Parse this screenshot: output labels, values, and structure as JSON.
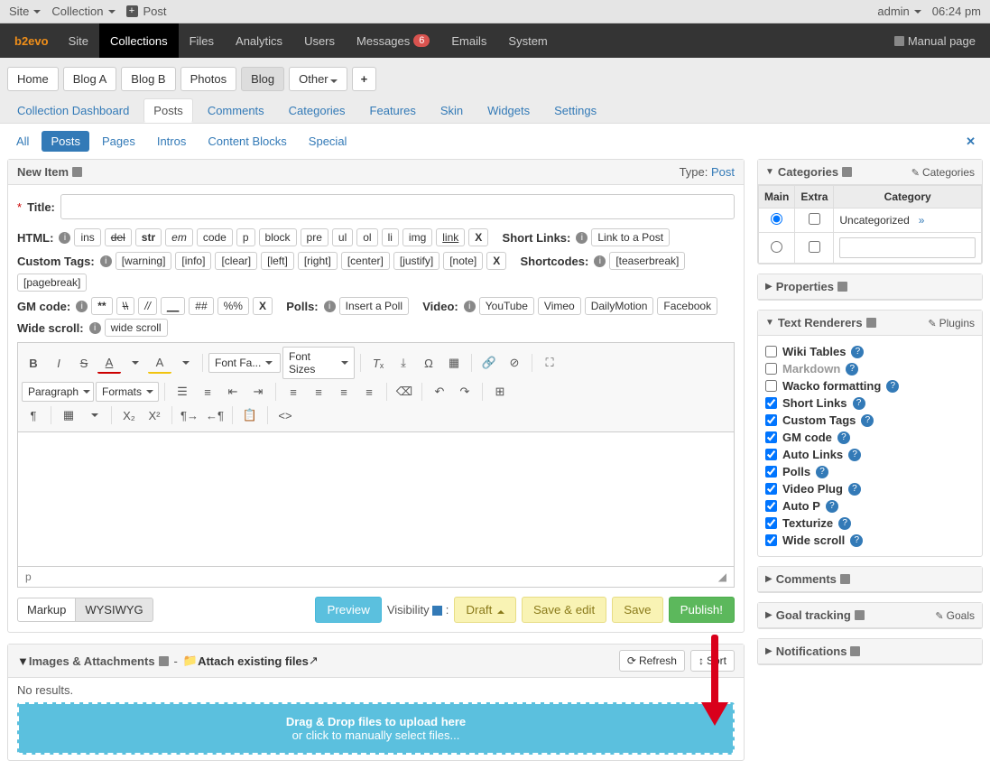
{
  "topbar": {
    "site": "Site",
    "collection": "Collection",
    "post": "Post",
    "user": "admin",
    "time": "06:24 pm"
  },
  "mainnav": {
    "brand": "b2evo",
    "items": [
      "Site",
      "Collections",
      "Files",
      "Analytics",
      "Users",
      "Messages",
      "Emails",
      "System"
    ],
    "messages_badge": "6",
    "manual": "Manual page"
  },
  "blogs": [
    "Home",
    "Blog A",
    "Blog B",
    "Photos",
    "Blog",
    "Other"
  ],
  "blogs_active": "Blog",
  "colltabs": [
    "Collection Dashboard",
    "Posts",
    "Comments",
    "Categories",
    "Features",
    "Skin",
    "Widgets",
    "Settings"
  ],
  "colltabs_active": "Posts",
  "subtabs": [
    "All",
    "Posts",
    "Pages",
    "Intros",
    "Content Blocks",
    "Special"
  ],
  "subtabs_active": "Posts",
  "newitem": {
    "title": "New Item",
    "type_label": "Type:",
    "type_value": "Post",
    "title_label": "Title:"
  },
  "html_toolbar": {
    "label": "HTML:",
    "buttons": [
      "ins",
      "del",
      "str",
      "em",
      "code",
      "p",
      "block",
      "pre",
      "ul",
      "ol",
      "li",
      "img",
      "link",
      "X"
    ]
  },
  "shortlinks": {
    "label": "Short Links:",
    "button": "Link to a Post"
  },
  "customtags": {
    "label": "Custom Tags:",
    "buttons": [
      "[warning]",
      "[info]",
      "[clear]",
      "[left]",
      "[right]",
      "[center]",
      "[justify]",
      "[note]",
      "X"
    ]
  },
  "shortcodes": {
    "label": "Shortcodes:",
    "buttons": [
      "[teaserbreak]",
      "[pagebreak]"
    ]
  },
  "gmcode": {
    "label": "GM code:",
    "buttons": [
      "**",
      "\\\\",
      "//",
      "__",
      "##",
      "%%",
      "X"
    ]
  },
  "polls": {
    "label": "Polls:",
    "button": "Insert a Poll"
  },
  "video": {
    "label": "Video:",
    "buttons": [
      "YouTube",
      "Vimeo",
      "DailyMotion",
      "Facebook"
    ]
  },
  "widescroll": {
    "label": "Wide scroll:",
    "button": "wide scroll"
  },
  "editor": {
    "paragraph": "Paragraph",
    "formats": "Formats",
    "fontfamily": "Font Fa...",
    "fontsizes": "Font Sizes",
    "status": "p"
  },
  "bottom": {
    "markup": "Markup",
    "wysiwyg": "WYSIWYG",
    "preview": "Preview",
    "visibility": "Visibility",
    "draft": "Draft",
    "save_edit": "Save & edit",
    "save": "Save",
    "publish": "Publish!"
  },
  "attachments": {
    "title": "Images & Attachments",
    "attach_existing": "Attach existing files",
    "refresh": "Refresh",
    "sort": "Sort",
    "no_results": "No results.",
    "drop1": "Drag & Drop files to upload here",
    "drop2": "or click to manually select files..."
  },
  "side": {
    "categories": {
      "title": "Categories",
      "edit": "Categories",
      "main": "Main",
      "extra": "Extra",
      "category": "Category",
      "uncategorized": "Uncategorized",
      "raquo": "»"
    },
    "properties": "Properties",
    "textrenderers": {
      "title": "Text Renderers",
      "edit": "Plugins",
      "items": [
        {
          "name": "Wiki Tables",
          "checked": false,
          "muted": false
        },
        {
          "name": "Markdown",
          "checked": false,
          "muted": true
        },
        {
          "name": "Wacko formatting",
          "checked": false,
          "muted": false
        },
        {
          "name": "Short Links",
          "checked": true,
          "muted": false
        },
        {
          "name": "Custom Tags",
          "checked": true,
          "muted": false
        },
        {
          "name": "GM code",
          "checked": true,
          "muted": false
        },
        {
          "name": "Auto Links",
          "checked": true,
          "muted": false
        },
        {
          "name": "Polls",
          "checked": true,
          "muted": false
        },
        {
          "name": "Video Plug",
          "checked": true,
          "muted": false
        },
        {
          "name": "Auto P",
          "checked": true,
          "muted": false
        },
        {
          "name": "Texturize",
          "checked": true,
          "muted": false
        },
        {
          "name": "Wide scroll",
          "checked": true,
          "muted": false
        }
      ]
    },
    "comments": "Comments",
    "goaltracking": {
      "title": "Goal tracking",
      "edit": "Goals"
    },
    "notifications": "Notifications"
  }
}
